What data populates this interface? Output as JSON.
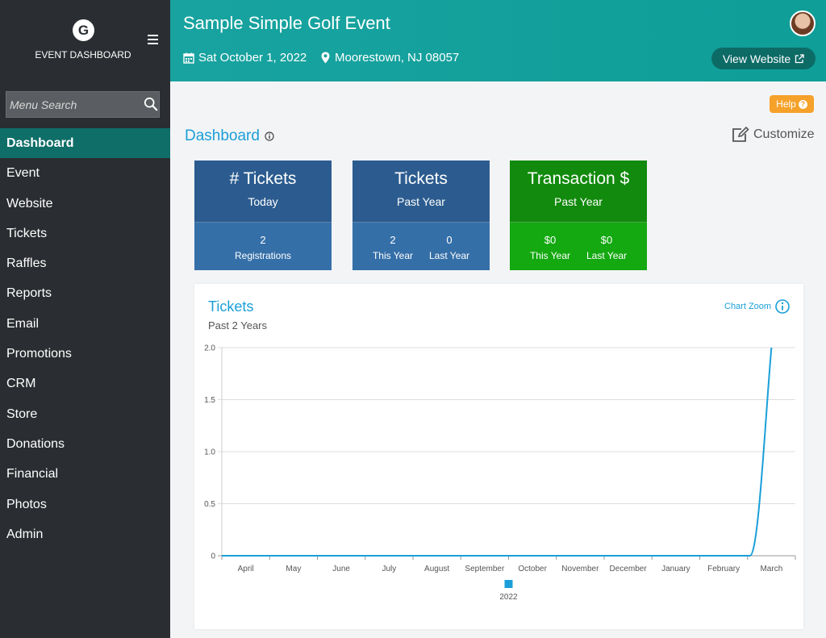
{
  "sidebar": {
    "logo_letter": "G",
    "title": "EVENT DASHBOARD",
    "search_placeholder": "Menu Search",
    "items": [
      {
        "label": "Dashboard",
        "active": true
      },
      {
        "label": "Event"
      },
      {
        "label": "Website"
      },
      {
        "label": "Tickets"
      },
      {
        "label": "Raffles"
      },
      {
        "label": "Reports"
      },
      {
        "label": "Email"
      },
      {
        "label": "Promotions"
      },
      {
        "label": "CRM"
      },
      {
        "label": "Store"
      },
      {
        "label": "Donations"
      },
      {
        "label": "Financial"
      },
      {
        "label": "Photos"
      },
      {
        "label": "Admin"
      }
    ]
  },
  "header": {
    "event_title": "Sample Simple Golf Event",
    "date": "Sat October 1, 2022",
    "location": "Moorestown, NJ 08057",
    "view_website_label": "View Website"
  },
  "main": {
    "help_label": "Help",
    "page_title": "Dashboard",
    "customize_label": "Customize"
  },
  "cards": [
    {
      "title": "# Tickets",
      "subtitle": "Today",
      "stats": [
        {
          "value": "2",
          "label": "Registrations"
        }
      ],
      "color": "#2c5c8f"
    },
    {
      "title": "Tickets",
      "subtitle": "Past Year",
      "stats": [
        {
          "value": "2",
          "label": "This Year"
        },
        {
          "value": "0",
          "label": "Last Year"
        }
      ],
      "color": "#2c5c8f"
    },
    {
      "title": "Transaction $",
      "subtitle": "Past Year",
      "stats": [
        {
          "value": "$0",
          "label": "This Year"
        },
        {
          "value": "$0",
          "label": "Last Year"
        }
      ],
      "color": "#118a0d"
    }
  ],
  "chart_panel": {
    "title": "Tickets",
    "subtitle": "Past 2 Years",
    "zoom_label": "Chart Zoom"
  },
  "chart_data": {
    "type": "line",
    "x": [
      "April",
      "May",
      "June",
      "July",
      "August",
      "September",
      "October",
      "November",
      "December",
      "January",
      "February",
      "March"
    ],
    "series": [
      {
        "name": "2022",
        "values": [
          0,
          0,
          0,
          0,
          0,
          0,
          0,
          0,
          0,
          0,
          0,
          2
        ],
        "color": "#1a9fd8"
      }
    ],
    "y_ticks": [
      "0",
      "0.5",
      "1.0",
      "1.5",
      "2.0"
    ],
    "ylim": [
      0,
      2
    ],
    "grid": true,
    "legend_placement": "bottom"
  }
}
